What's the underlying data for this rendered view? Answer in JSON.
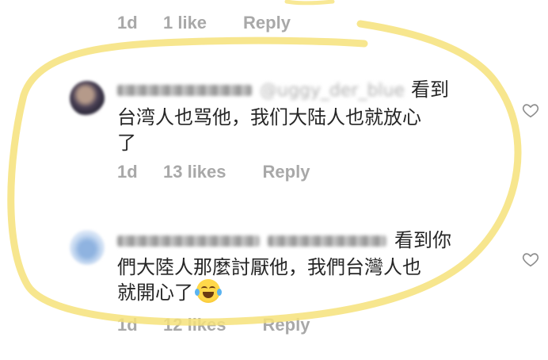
{
  "top_meta": {
    "time": "1d",
    "likes": "1 like",
    "reply": "Reply"
  },
  "comments": [
    {
      "mention": "@uggy_der_blue",
      "line1": "看到",
      "line2": "台湾人也骂他，我们大陆人也就放心",
      "line3": "了",
      "time": "1d",
      "likes": "13 likes",
      "reply": "Reply"
    },
    {
      "line1": "看到你",
      "line2": "們大陸人那麼討厭他，我們台灣人也",
      "line3": "就開心了",
      "emoji": "face-with-tears-of-joy",
      "time": "1d",
      "likes": "12 likes",
      "reply": "Reply"
    }
  ],
  "colors": {
    "highlight": "#f6e27a",
    "meta_text": "#a8a8a8",
    "body_text": "#262626"
  },
  "icons": {
    "like": "heart-outline-icon"
  }
}
